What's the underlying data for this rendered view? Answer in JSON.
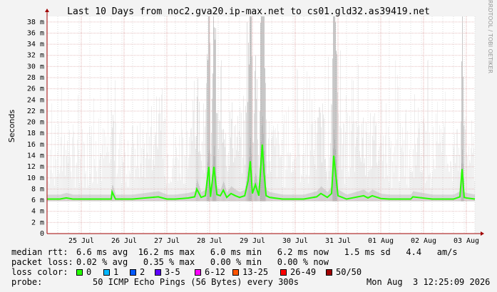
{
  "chart_data": {
    "type": "area",
    "title": "Last 10 Days from noc2.gva20.ip-max.net to cs01.gld32.as39419.net",
    "ylabel": "Seconds",
    "ylim": [
      0,
      0.039
    ],
    "yticks": [
      {
        "v": 0,
        "label": "0"
      },
      {
        "v": 0.002,
        "label": "2 m"
      },
      {
        "v": 0.004,
        "label": "4 m"
      },
      {
        "v": 0.006,
        "label": "6 m"
      },
      {
        "v": 0.008,
        "label": "8 m"
      },
      {
        "v": 0.01,
        "label": "10 m"
      },
      {
        "v": 0.012,
        "label": "12 m"
      },
      {
        "v": 0.014,
        "label": "14 m"
      },
      {
        "v": 0.016,
        "label": "16 m"
      },
      {
        "v": 0.018,
        "label": "18 m"
      },
      {
        "v": 0.02,
        "label": "20 m"
      },
      {
        "v": 0.022,
        "label": "22 m"
      },
      {
        "v": 0.024,
        "label": "24 m"
      },
      {
        "v": 0.026,
        "label": "26 m"
      },
      {
        "v": 0.028,
        "label": "28 m"
      },
      {
        "v": 0.03,
        "label": "30 m"
      },
      {
        "v": 0.032,
        "label": "32 m"
      },
      {
        "v": 0.034,
        "label": "34 m"
      },
      {
        "v": 0.036,
        "label": "36 m"
      },
      {
        "v": 0.038,
        "label": "38 m"
      }
    ],
    "xlim": [
      0,
      10
    ],
    "xticks": [
      {
        "v": 0.8,
        "label": "25 Jul"
      },
      {
        "v": 1.8,
        "label": "26 Jul"
      },
      {
        "v": 2.8,
        "label": "27 Jul"
      },
      {
        "v": 3.8,
        "label": "28 Jul"
      },
      {
        "v": 4.8,
        "label": "29 Jul"
      },
      {
        "v": 5.8,
        "label": "30 Jul"
      },
      {
        "v": 6.8,
        "label": "31 Jul"
      },
      {
        "v": 7.8,
        "label": "01 Aug"
      },
      {
        "v": 8.8,
        "label": "02 Aug"
      },
      {
        "v": 9.8,
        "label": "03 Aug"
      }
    ],
    "grid": true,
    "series": [
      {
        "name": "median rtt",
        "x": [
          0,
          0.3,
          0.45,
          0.6,
          1.0,
          1.5,
          1.52,
          1.6,
          2.0,
          2.6,
          2.8,
          3.0,
          3.3,
          3.45,
          3.5,
          3.6,
          3.7,
          3.78,
          3.82,
          3.9,
          3.97,
          4.05,
          4.12,
          4.2,
          4.3,
          4.4,
          4.5,
          4.62,
          4.7,
          4.75,
          4.8,
          4.87,
          4.95,
          5.03,
          5.07,
          5.12,
          5.2,
          5.5,
          6.0,
          6.3,
          6.4,
          6.55,
          6.65,
          6.7,
          6.8,
          7.0,
          7.4,
          7.5,
          7.6,
          7.8,
          8.0,
          8.5,
          8.55,
          9.0,
          9.5,
          9.65,
          9.7,
          9.75,
          9.8,
          10.0
        ],
        "y": [
          0.0062,
          0.0062,
          0.0064,
          0.0062,
          0.0062,
          0.0062,
          0.0075,
          0.0062,
          0.0062,
          0.0066,
          0.0062,
          0.0062,
          0.0064,
          0.0066,
          0.008,
          0.0065,
          0.0068,
          0.012,
          0.0066,
          0.012,
          0.007,
          0.0068,
          0.0078,
          0.0065,
          0.0072,
          0.0068,
          0.0065,
          0.0068,
          0.0095,
          0.013,
          0.0072,
          0.0088,
          0.0068,
          0.016,
          0.011,
          0.0068,
          0.0065,
          0.0062,
          0.0062,
          0.0066,
          0.0072,
          0.0065,
          0.0072,
          0.014,
          0.0068,
          0.0062,
          0.0068,
          0.0064,
          0.0068,
          0.0063,
          0.0062,
          0.0062,
          0.0066,
          0.0062,
          0.0062,
          0.0066,
          0.0116,
          0.0065,
          0.0064,
          0.0062
        ]
      }
    ],
    "legend": "bottom",
    "rrdtool_label": "RRDTOOL / TOBI OETIKER"
  },
  "stats": {
    "rtt_label": "median rtt:",
    "rtt_values": "6.6 ms avg  16.2 ms max   6.0 ms min   6.2 ms now   1.5 ms sd   4.4   am/s",
    "loss_label": "packet loss:",
    "loss_values": "0.02 % avg   0.35 % max   0.00 % min   0.00 % now",
    "color_label": "loss color:",
    "probe_label": "probe:",
    "probe_value": "50 ICMP Echo Pings (56 Bytes) every 300s",
    "timestamp": "Mon Aug  3 12:25:09 2026"
  },
  "loss_colors": [
    {
      "label": "0",
      "color": "#26ff00"
    },
    {
      "label": "1",
      "color": "#00b8ff"
    },
    {
      "label": "2",
      "color": "#0059ff"
    },
    {
      "label": "3-5",
      "color": "#5e00ff"
    },
    {
      "label": "6-12",
      "color": "#ff00ff"
    },
    {
      "label": "13-25",
      "color": "#ff5500"
    },
    {
      "label": "26-49",
      "color": "#ff0000"
    },
    {
      "label": "50/50",
      "color": "#a10000"
    }
  ],
  "colors": {
    "background": "#f3f3f3",
    "plot_bg": "#ffffff",
    "grid_major": "#e0b0b0",
    "grid_minor": "#dddddd",
    "axis": "#a00000",
    "smoke": "#555555",
    "median": "#26ff00"
  }
}
